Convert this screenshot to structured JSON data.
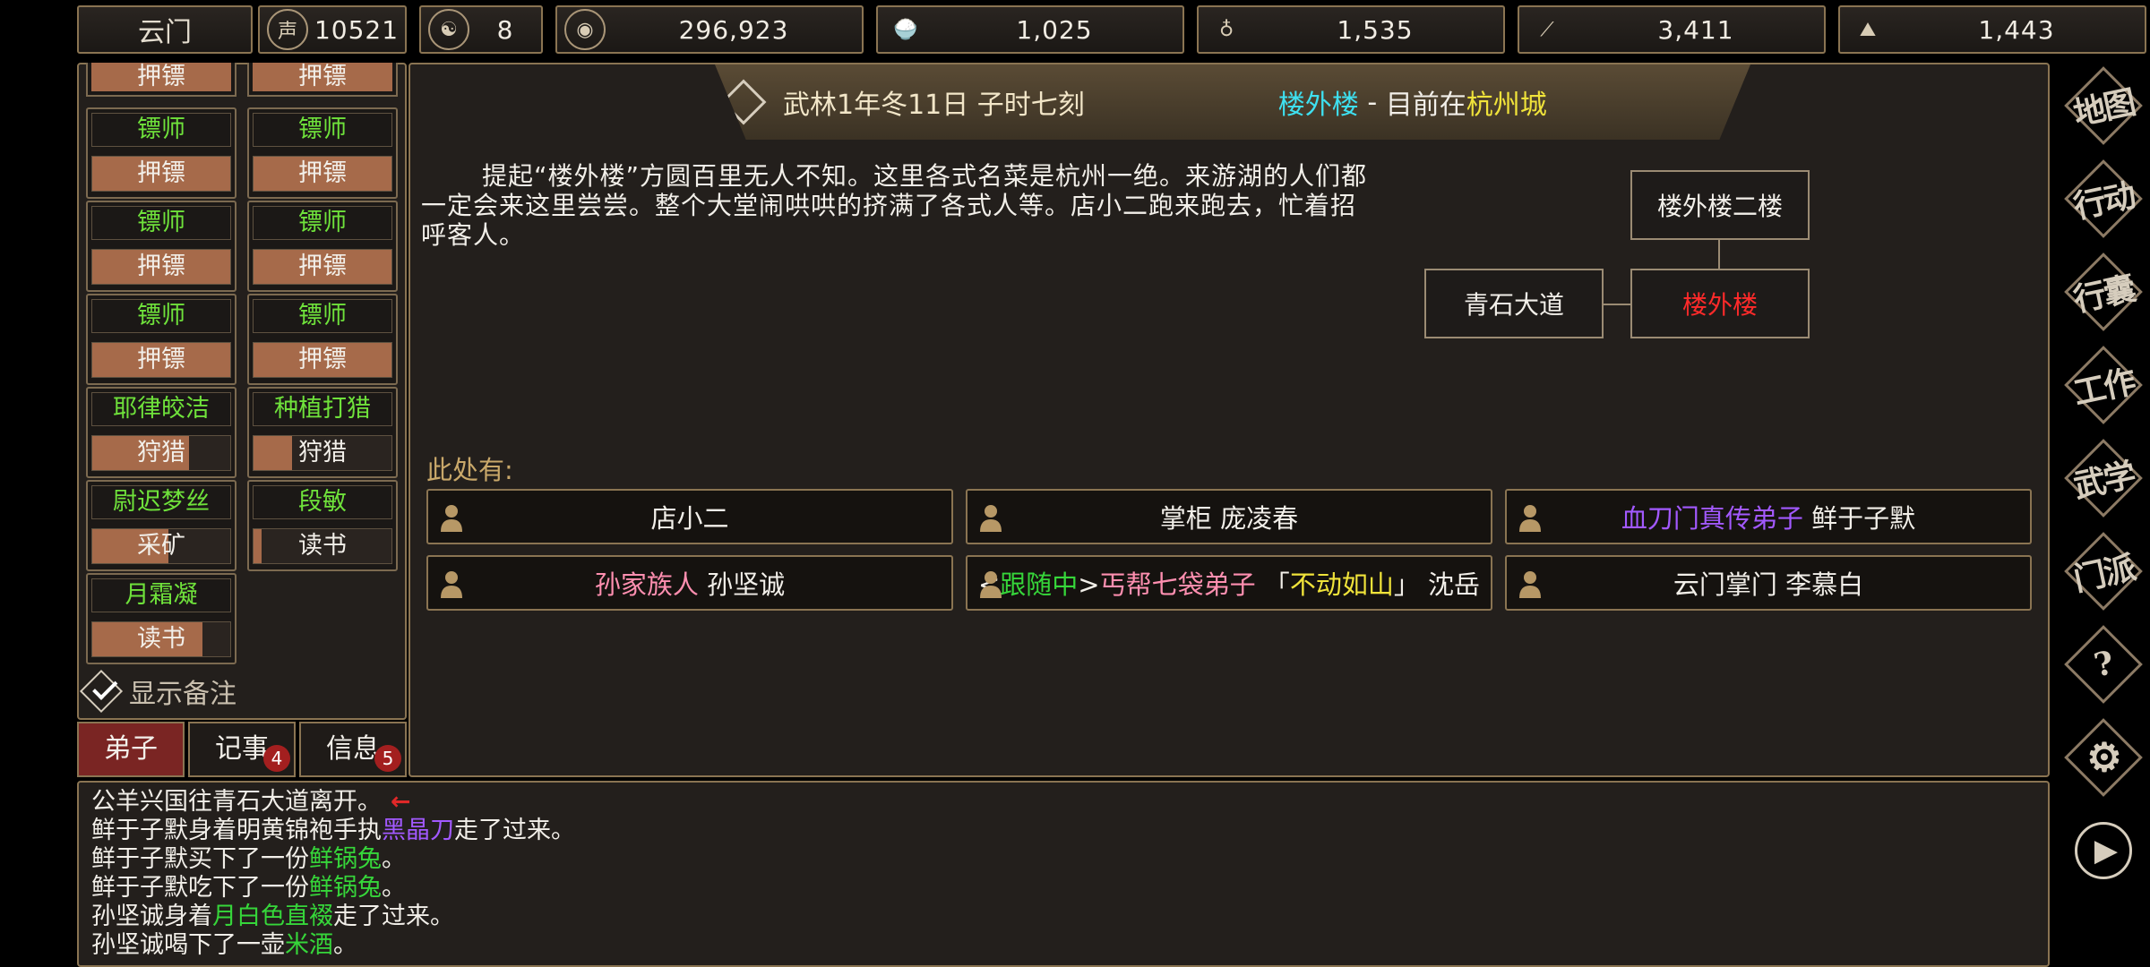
{
  "top_bar": {
    "sect": "云门",
    "items": [
      {
        "icon": "reputation-icon",
        "value": "10521"
      },
      {
        "icon": "yin-yang-icon",
        "value": "8"
      },
      {
        "icon": "coin-icon",
        "value": "296,923"
      },
      {
        "icon": "food-bowl-icon",
        "value": "1,025"
      },
      {
        "icon": "gourd-icon",
        "value": "1,535"
      },
      {
        "icon": "wood-log-icon",
        "value": "3,411"
      },
      {
        "icon": "ore-icon",
        "value": "1,443"
      }
    ]
  },
  "left_panel": {
    "partial_row": [
      "押镖",
      "押镖"
    ],
    "jobs": [
      {
        "name": "镖师",
        "action": "押镖",
        "progress": 1.0
      },
      {
        "name": "镖师",
        "action": "押镖",
        "progress": 1.0
      },
      {
        "name": "镖师",
        "action": "押镖",
        "progress": 1.0
      },
      {
        "name": "镖师",
        "action": "押镖",
        "progress": 1.0
      },
      {
        "name": "镖师",
        "action": "押镖",
        "progress": 1.0
      },
      {
        "name": "镖师",
        "action": "押镖",
        "progress": 1.0
      },
      {
        "name": "耶律皎洁",
        "action": "狩猎",
        "progress": 0.7
      },
      {
        "name": "种植打猎",
        "action": "狩猎",
        "progress": 0.28
      },
      {
        "name": "尉迟梦丝",
        "action": "采矿",
        "progress": 0.55
      },
      {
        "name": "段敏",
        "action": "读书",
        "progress": 0.06
      },
      {
        "name": "月霜凝",
        "action": "读书",
        "progress": 0.8
      }
    ],
    "show_notes_label": "显示备注",
    "tabs": [
      {
        "label": "弟子",
        "badge": ""
      },
      {
        "label": "记事",
        "badge": "4"
      },
      {
        "label": "信息",
        "badge": "5"
      }
    ]
  },
  "header": {
    "date": "武林1年冬11日 子时七刻",
    "location": "楼外楼",
    "separator": " - ",
    "currently_at": "目前在",
    "city": "杭州城"
  },
  "description": "提起“楼外楼”方圆百里无人不知。这里各式名菜是杭州一绝。来游湖的人们都一定会来这里尝尝。整个大堂闹哄哄的挤满了各式人等。店小二跑来跑去，忙着招呼客人。",
  "map": {
    "north": "楼外楼二楼",
    "west": "青石大道",
    "current": "楼外楼"
  },
  "here_label": "此处有:",
  "npcs": [
    {
      "parts": [
        {
          "text": "店小二",
          "color": "#f2efe9"
        }
      ]
    },
    {
      "parts": [
        {
          "text": "掌柜 庞凌春",
          "color": "#f2efe9"
        }
      ]
    },
    {
      "parts": [
        {
          "text": "血刀门真传弟子",
          "color": "#a259ff"
        },
        {
          "text": " 鲜于子默",
          "color": "#f2efe9"
        }
      ]
    },
    {
      "parts": [
        {
          "text": "孙家族人",
          "color": "#ff8fb0"
        },
        {
          "text": " 孙坚诚",
          "color": "#f2efe9"
        }
      ]
    },
    {
      "parts": [
        {
          "text": "<",
          "color": "#f2efe9"
        },
        {
          "text": "跟随中",
          "color": "#36d63a"
        },
        {
          "text": ">",
          "color": "#f2efe9"
        },
        {
          "text": "丐帮七袋弟子",
          "color": "#ff8fb0"
        },
        {
          "text": " 「",
          "color": "#f2efe9"
        },
        {
          "text": "不动如山",
          "color": "#f0e33a"
        },
        {
          "text": "」 沈岳",
          "color": "#f2efe9"
        }
      ]
    },
    {
      "parts": [
        {
          "text": "云门掌门 李慕白",
          "color": "#f2efe9"
        }
      ]
    }
  ],
  "right_menu": [
    "地图",
    "行动",
    "行囊",
    "工作",
    "武学",
    "门派",
    "?",
    "settings",
    "play"
  ],
  "log": [
    [
      {
        "text": "公羊兴国往青石大道离开。",
        "color": "#f2efe9"
      },
      {
        "text": "←",
        "color": "#e02828"
      }
    ],
    [
      {
        "text": "鲜于子默身着明黄锦袍手执",
        "color": "#f2efe9"
      },
      {
        "text": "黑晶刀",
        "color": "#a259ff"
      },
      {
        "text": "走了过来。",
        "color": "#f2efe9"
      }
    ],
    [
      {
        "text": "鲜于子默买下了一份",
        "color": "#f2efe9"
      },
      {
        "text": "鲜锅兔",
        "color": "#36d63a"
      },
      {
        "text": "。",
        "color": "#f2efe9"
      }
    ],
    [
      {
        "text": "鲜于子默吃下了一份",
        "color": "#f2efe9"
      },
      {
        "text": "鲜锅兔",
        "color": "#36d63a"
      },
      {
        "text": "。",
        "color": "#f2efe9"
      }
    ],
    [
      {
        "text": "孙坚诚身着",
        "color": "#f2efe9"
      },
      {
        "text": "月白色直裰",
        "color": "#36d63a"
      },
      {
        "text": "走了过来。",
        "color": "#f2efe9"
      }
    ],
    [
      {
        "text": "孙坚诚喝下了一壶",
        "color": "#f2efe9"
      },
      {
        "text": "米酒",
        "color": "#36d63a"
      },
      {
        "text": "。",
        "color": "#f2efe9"
      }
    ]
  ],
  "colors": {
    "job_name": "#6fe23b",
    "location": "#3ee0f0",
    "city": "#f0e33a",
    "current_room": "#ff2a2a",
    "here_label": "#c9a86a"
  }
}
